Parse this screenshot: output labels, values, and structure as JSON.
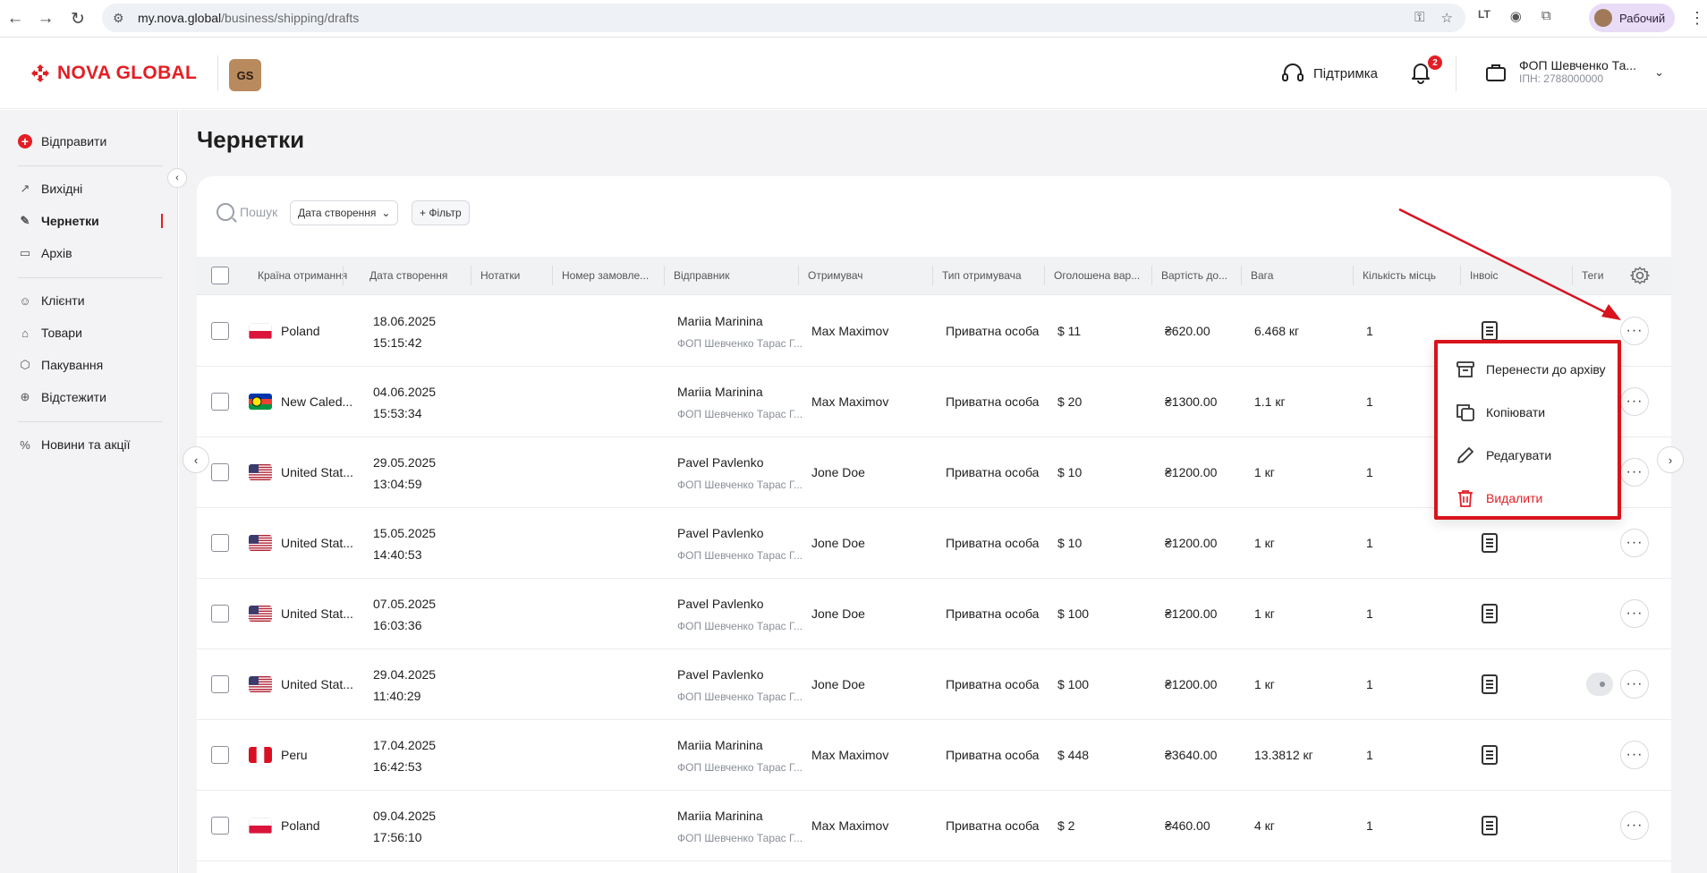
{
  "browser": {
    "url_domain": "my.nova.global",
    "url_path": "/business/shipping/drafts",
    "profile_label": "Рабочий"
  },
  "header": {
    "logo_text": "NOVA GLOBAL",
    "badge_text": "GS",
    "support_label": "Підтримка",
    "notifications_count": "2",
    "company_name": "ФОП Шевченко Та...",
    "company_inn": "ІПН: 2788000000"
  },
  "sidebar": {
    "send_label": "Відправити",
    "items": [
      {
        "label": "Вихідні",
        "icon": "arrow-up-right-icon"
      },
      {
        "label": "Чернетки",
        "icon": "edit-icon"
      },
      {
        "label": "Архів",
        "icon": "archive-icon"
      },
      {
        "label": "Клієнти",
        "icon": "users-icon"
      },
      {
        "label": "Товари",
        "icon": "tag-icon"
      },
      {
        "label": "Пакування",
        "icon": "box-icon"
      },
      {
        "label": "Відстежити",
        "icon": "target-icon"
      },
      {
        "label": "Новини та акції",
        "icon": "percent-icon"
      }
    ],
    "active_item": "Чернетки"
  },
  "page": {
    "title": "Чернетки",
    "search_placeholder": "Пошук",
    "date_filter_label": "Дата створення",
    "add_filter_label": "+ Фільтр"
  },
  "table": {
    "columns": [
      "Країна отримання",
      "Дата створення",
      "Нотатки",
      "Номер замовле...",
      "Відправник",
      "Отримувач",
      "Тип отримувача",
      "Оголошена вар...",
      "Вартість до...",
      "Вага",
      "Кількість місць",
      "Інвоіс",
      "Теги"
    ],
    "rows": [
      {
        "country": "Poland",
        "flag": "pl",
        "date": "18.06.2025",
        "time": "15:15:42",
        "sender": "Mariia Marinina",
        "sender_company": "ФОП Шевченко Тарас Г...",
        "recipient": "Max Maximov",
        "recipient_type": "Приватна особа",
        "declared": "$ 11",
        "cost": "₴620.00",
        "weight": "6.468 кг",
        "places": "1",
        "has_tag": false
      },
      {
        "country": "New Caled...",
        "flag": "nc",
        "date": "04.06.2025",
        "time": "15:53:34",
        "sender": "Mariia Marinina",
        "sender_company": "ФОП Шевченко Тарас Г...",
        "recipient": "Max Maximov",
        "recipient_type": "Приватна особа",
        "declared": "$ 20",
        "cost": "₴1300.00",
        "weight": "1.1 кг",
        "places": "1",
        "has_tag": false
      },
      {
        "country": "United Stat...",
        "flag": "us",
        "date": "29.05.2025",
        "time": "13:04:59",
        "sender": "Pavel Pavlenko",
        "sender_company": "ФОП Шевченко Тарас Г...",
        "recipient": "Jone Doe",
        "recipient_type": "Приватна особа",
        "declared": "$ 10",
        "cost": "₴1200.00",
        "weight": "1 кг",
        "places": "1",
        "has_tag": false
      },
      {
        "country": "United Stat...",
        "flag": "us",
        "date": "15.05.2025",
        "time": "14:40:53",
        "sender": "Pavel Pavlenko",
        "sender_company": "ФОП Шевченко Тарас Г...",
        "recipient": "Jone Doe",
        "recipient_type": "Приватна особа",
        "declared": "$ 10",
        "cost": "₴1200.00",
        "weight": "1 кг",
        "places": "1",
        "has_tag": false
      },
      {
        "country": "United Stat...",
        "flag": "us",
        "date": "07.05.2025",
        "time": "16:03:36",
        "sender": "Pavel Pavlenko",
        "sender_company": "ФОП Шевченко Тарас Г...",
        "recipient": "Jone Doe",
        "recipient_type": "Приватна особа",
        "declared": "$ 100",
        "cost": "₴1200.00",
        "weight": "1 кг",
        "places": "1",
        "has_tag": false
      },
      {
        "country": "United Stat...",
        "flag": "us",
        "date": "29.04.2025",
        "time": "11:40:29",
        "sender": "Pavel Pavlenko",
        "sender_company": "ФОП Шевченко Тарас Г...",
        "recipient": "Jone Doe",
        "recipient_type": "Приватна особа",
        "declared": "$ 100",
        "cost": "₴1200.00",
        "weight": "1 кг",
        "places": "1",
        "has_tag": true
      },
      {
        "country": "Peru",
        "flag": "pe",
        "date": "17.04.2025",
        "time": "16:42:53",
        "sender": "Mariia Marinina",
        "sender_company": "ФОП Шевченко Тарас Г...",
        "recipient": "Max Maximov",
        "recipient_type": "Приватна особа",
        "declared": "$ 448",
        "cost": "₴3640.00",
        "weight": "13.3812 кг",
        "places": "1",
        "has_tag": false
      },
      {
        "country": "Poland",
        "flag": "pl",
        "date": "09.04.2025",
        "time": "17:56:10",
        "sender": "Mariia Marinina",
        "sender_company": "ФОП Шевченко Тарас Г...",
        "recipient": "Max Maximov",
        "recipient_type": "Приватна особа",
        "declared": "$ 2",
        "cost": "₴460.00",
        "weight": "4 кг",
        "places": "1",
        "has_tag": false
      }
    ]
  },
  "context_menu": {
    "items": [
      {
        "label": "Перенести до архіву",
        "icon": "archive-icon",
        "danger": false
      },
      {
        "label": "Копіювати",
        "icon": "copy-icon",
        "danger": false
      },
      {
        "label": "Редагувати",
        "icon": "pencil-icon",
        "danger": false
      },
      {
        "label": "Видалити",
        "icon": "trash-icon",
        "danger": true
      }
    ]
  },
  "colors": {
    "brand_red": "#e31e24",
    "highlight_red": "#d8131b"
  }
}
